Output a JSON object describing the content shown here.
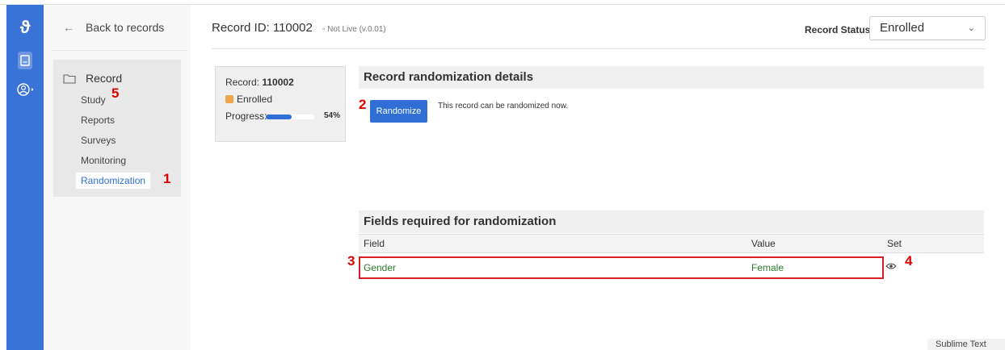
{
  "app": {
    "logo": "ϑ"
  },
  "sidebar": {
    "back_label": "Back to records",
    "section_title": "Record",
    "items": [
      {
        "label": "Study"
      },
      {
        "label": "Reports"
      },
      {
        "label": "Surveys"
      },
      {
        "label": "Monitoring"
      },
      {
        "label": "Randomization",
        "active": true
      }
    ]
  },
  "header": {
    "record_id": "Record ID: 110002",
    "live_status": "◦ Not Live (v.0.01)",
    "status_label": "Record Status:",
    "status_value": "Enrolled"
  },
  "summary": {
    "record_label": "Record: ",
    "record_number": "110002",
    "status": "Enrolled",
    "progress_label": "Progress:",
    "progress_value": 54,
    "progress_text": "54%"
  },
  "randomization": {
    "title": "Record randomization details",
    "button_label": "Randomize",
    "message": "This record can be randomized now."
  },
  "fields_table": {
    "title": "Fields required for randomization",
    "columns": [
      "Field",
      "Value",
      "Set"
    ],
    "rows": [
      {
        "field": "Gender",
        "value": "Female"
      }
    ]
  },
  "annotations": [
    "1",
    "2",
    "3",
    "4",
    "5"
  ],
  "taskbar": {
    "label": "Sublime Text"
  },
  "colors": {
    "accent": "#2f6fd6",
    "rail": "#3a73d8",
    "highlight": "#d9202a",
    "enrolled": "#f0a54a",
    "field_text": "#2d7d2d"
  }
}
